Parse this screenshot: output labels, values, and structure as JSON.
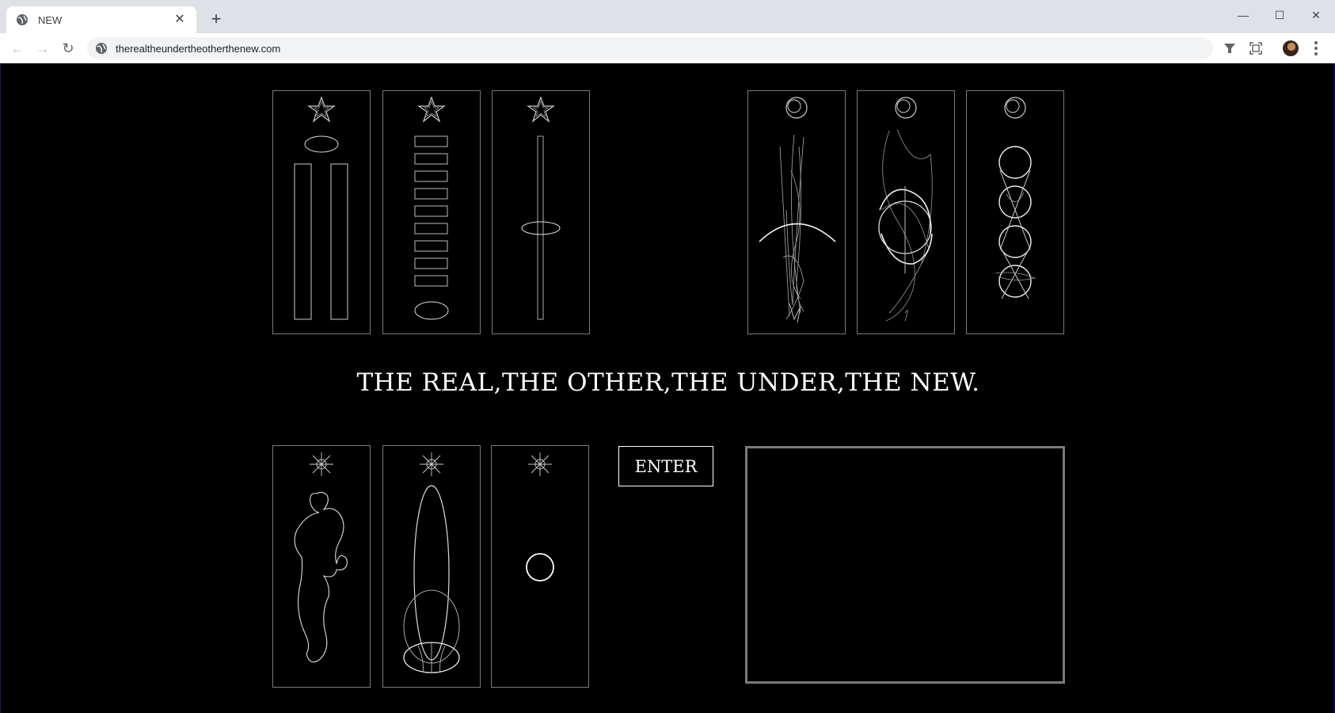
{
  "browser": {
    "tab_title": "NEW",
    "url": "therealtheundertheotherthenew.com"
  },
  "page": {
    "headline": "THE REAL,THE OTHER,THE UNDER,THE NEW.",
    "enter_label": "ENTER"
  },
  "colors": {
    "background": "#000000",
    "line": "#ffffff",
    "card_border": "#7a7a7a"
  },
  "cards": [
    {
      "group": "star",
      "motif": "twin-pillars"
    },
    {
      "group": "star",
      "motif": "stacked-blocks"
    },
    {
      "group": "star",
      "motif": "rod-with-ring"
    },
    {
      "group": "moon",
      "motif": "scribble-with-arc"
    },
    {
      "group": "moon",
      "motif": "scribble-in-sphere"
    },
    {
      "group": "moon",
      "motif": "chain-of-circles"
    },
    {
      "group": "sun",
      "motif": "bubble-form"
    },
    {
      "group": "sun",
      "motif": "tall-ellipse"
    },
    {
      "group": "sun",
      "motif": "single-circle"
    }
  ]
}
